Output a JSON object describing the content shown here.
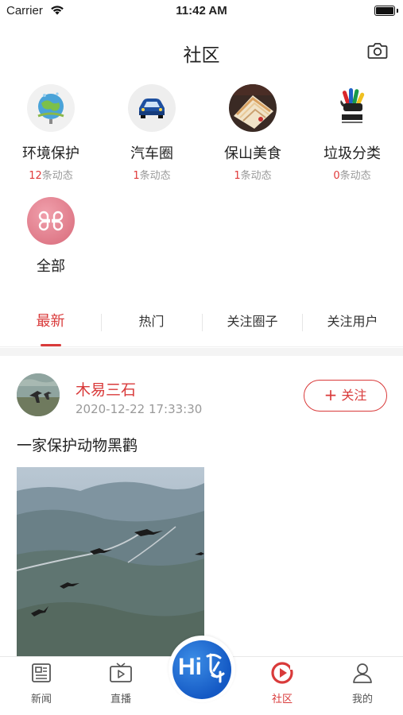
{
  "status_bar": {
    "carrier": "Carrier",
    "time": "11:42 AM"
  },
  "header": {
    "title": "社区"
  },
  "circles": [
    {
      "name": "环境保护",
      "count_num": "12",
      "count_suffix": "条动态",
      "icon": "earth-globe-icon"
    },
    {
      "name": "汽车圈",
      "count_num": "1",
      "count_suffix": "条动态",
      "icon": "car-icon"
    },
    {
      "name": "保山美食",
      "count_num": "1",
      "count_suffix": "条动态",
      "icon": "food-cake-image"
    },
    {
      "name": "垃圾分类",
      "count_num": "0",
      "count_suffix": "条动态",
      "icon": "waste-sorting-hand-logo"
    },
    {
      "name": "全部",
      "icon": "grid-clover-icon"
    }
  ],
  "tabs": [
    "最新",
    "热门",
    "关注圈子",
    "关注用户"
  ],
  "active_tab": "最新",
  "post": {
    "user_name": "木易三石",
    "timestamp": "2020-12-22 17:33:30",
    "follow_label": "关注",
    "text": "一家保护动物黑鹳"
  },
  "tabbar": {
    "items": [
      {
        "label": "新闻",
        "icon": "newspaper-icon"
      },
      {
        "label": "直播",
        "icon": "tv-icon"
      },
      {
        "label": "社区",
        "icon": "community-play-icon"
      },
      {
        "label": "我的",
        "icon": "user-icon"
      }
    ],
    "center_logo": "Hi",
    "active": "社区"
  },
  "colors": {
    "accent": "#d93a3a",
    "hub_blue": "#1a6ad6"
  }
}
